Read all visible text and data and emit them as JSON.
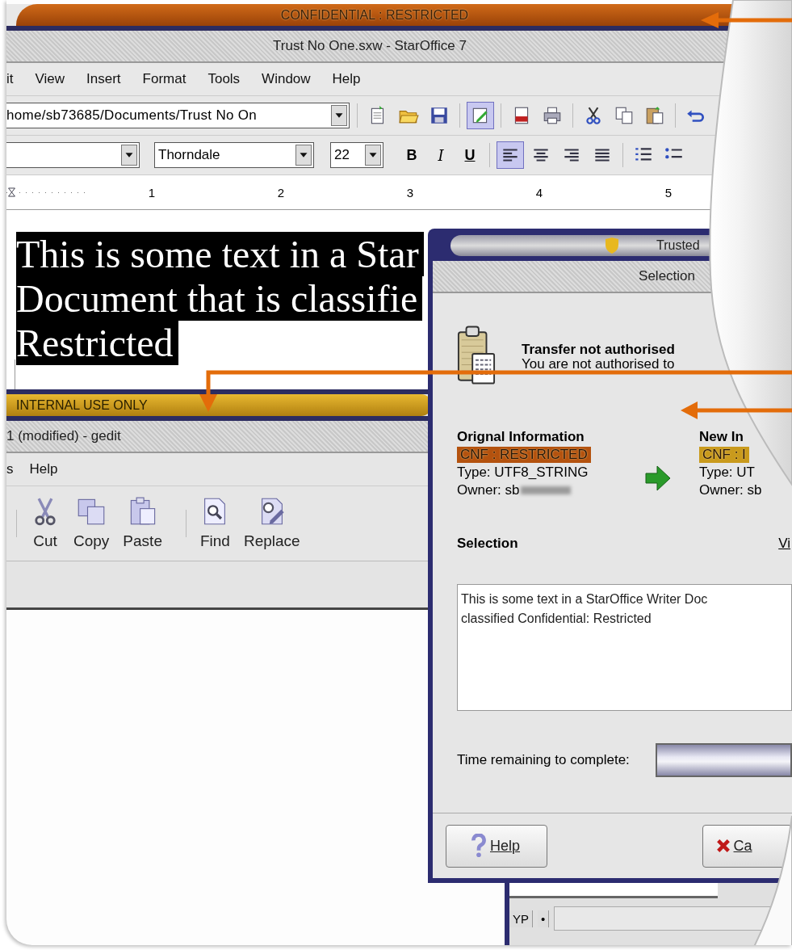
{
  "staroffice": {
    "classification": "CONFIDENTIAL : RESTRICTED",
    "title": "Trust No One.sxw - StarOffice 7",
    "menu": [
      "it",
      "View",
      "Insert",
      "Format",
      "Tools",
      "Window",
      "Help"
    ],
    "path": "home/sb73685/Documents/Trust No On",
    "edit_mode": {
      "selected": true
    },
    "font": "Thorndale",
    "size": "22",
    "styles": [
      {
        "label": "B",
        "kind": "bold"
      },
      {
        "label": "I",
        "kind": "italic"
      },
      {
        "label": "U",
        "kind": "underline"
      }
    ],
    "alignment": [
      {
        "kind": "left",
        "selected": true
      },
      {
        "kind": "center",
        "selected": false
      },
      {
        "kind": "right",
        "selected": false
      },
      {
        "kind": "justify",
        "selected": false
      }
    ],
    "ruler": [
      "1",
      "2",
      "3",
      "4",
      "5"
    ],
    "document": {
      "selected": true,
      "lines": [
        "This is some text in a Star",
        "Document that is classifie",
        "Restricted"
      ]
    }
  },
  "gedit": {
    "classification": "INTERNAL USE ONLY",
    "title": "1 (modified) - gedit",
    "menu": [
      "s",
      "Help"
    ],
    "toolbar": [
      {
        "label": "Cut",
        "kind": "cut"
      },
      {
        "label": "Copy",
        "kind": "copy"
      },
      {
        "label": "Paste",
        "kind": "paste"
      },
      {
        "label": "Find",
        "kind": "find"
      },
      {
        "label": "Replace",
        "kind": "replace"
      }
    ]
  },
  "dialog": {
    "title": "Trusted",
    "subtitle": "Selection",
    "heading": "Transfer not authorised",
    "message": "You are not authorised to",
    "info": [
      {
        "heading": "Orignal Information",
        "tag": "CNF : RESTRICTED",
        "color": "#b4520e",
        "type": "Type: UTF8_STRING",
        "owner": "Owner: sb",
        "redacted": true
      },
      {
        "heading": "New In",
        "tag": "CNF : I",
        "color": "#c99a1c",
        "type": "Type: UT",
        "owner": "Owner: sb"
      }
    ],
    "selection_label": "Selection",
    "view_link": "Vi",
    "selection_lines": [
      "This is some text in a StarOffice Writer Doc",
      "classified Confidential: Restricted"
    ],
    "time_label": "Time remaining to complete:",
    "progress": {
      "level": 1
    },
    "buttons": [
      {
        "label": "Help",
        "kind": "help"
      },
      {
        "label": "Ca",
        "kind": "cancel"
      }
    ]
  },
  "background_window": {
    "status": [
      "YP",
      "•"
    ]
  }
}
